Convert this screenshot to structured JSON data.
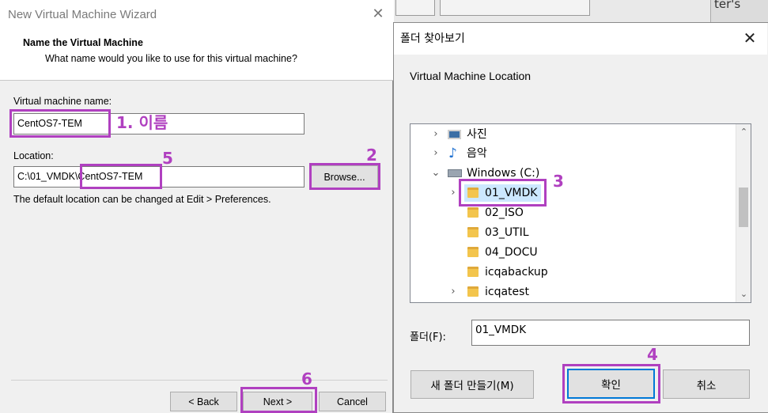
{
  "background": {
    "side_text": "ter's"
  },
  "wizard": {
    "title": "New Virtual Machine Wizard",
    "heading": "Name the Virtual Machine",
    "subheading": "What name would you like to use for this virtual machine?",
    "vm_name_label": "Virtual machine name:",
    "vm_name_value": "CentOS7-TEM",
    "location_label": "Location:",
    "location_value": "C:\\01_VMDK\\CentOS7-TEM",
    "browse_label": "Browse...",
    "note": "The default location can be changed at Edit > Preferences.",
    "back_label": "< Back",
    "next_label": "Next >",
    "cancel_label": "Cancel"
  },
  "folder_dialog": {
    "title": "폴더 찾아보기",
    "description": "Virtual Machine Location",
    "tree": [
      {
        "label": "사진",
        "icon": "picture-icon",
        "arrow": "›"
      },
      {
        "label": "음악",
        "icon": "music-icon",
        "arrow": "›"
      },
      {
        "label": "Windows (C:)",
        "icon": "drive-icon",
        "arrow": "⌄"
      },
      {
        "label": "01_VMDK",
        "icon": "folder-icon",
        "arrow": "›"
      },
      {
        "label": "02_ISO",
        "icon": "folder-icon",
        "arrow": ""
      },
      {
        "label": "03_UTIL",
        "icon": "folder-icon",
        "arrow": ""
      },
      {
        "label": "04_DOCU",
        "icon": "folder-icon",
        "arrow": ""
      },
      {
        "label": "icqabackup",
        "icon": "folder-icon",
        "arrow": ""
      },
      {
        "label": "icqatest",
        "icon": "folder-icon",
        "arrow": "›"
      }
    ],
    "folder_label": "폴더(F):",
    "folder_value": "01_VMDK",
    "new_folder_label": "새 폴더 만들기(M)",
    "ok_label": "확인",
    "cancel_label": "취소"
  },
  "annotations": {
    "a1": "1. 이름",
    "a2": "2",
    "a3": "3",
    "a4": "4",
    "a5": "5",
    "a6": "6"
  },
  "colors": {
    "highlight": "#b040c0",
    "selection": "#cce8ff"
  }
}
